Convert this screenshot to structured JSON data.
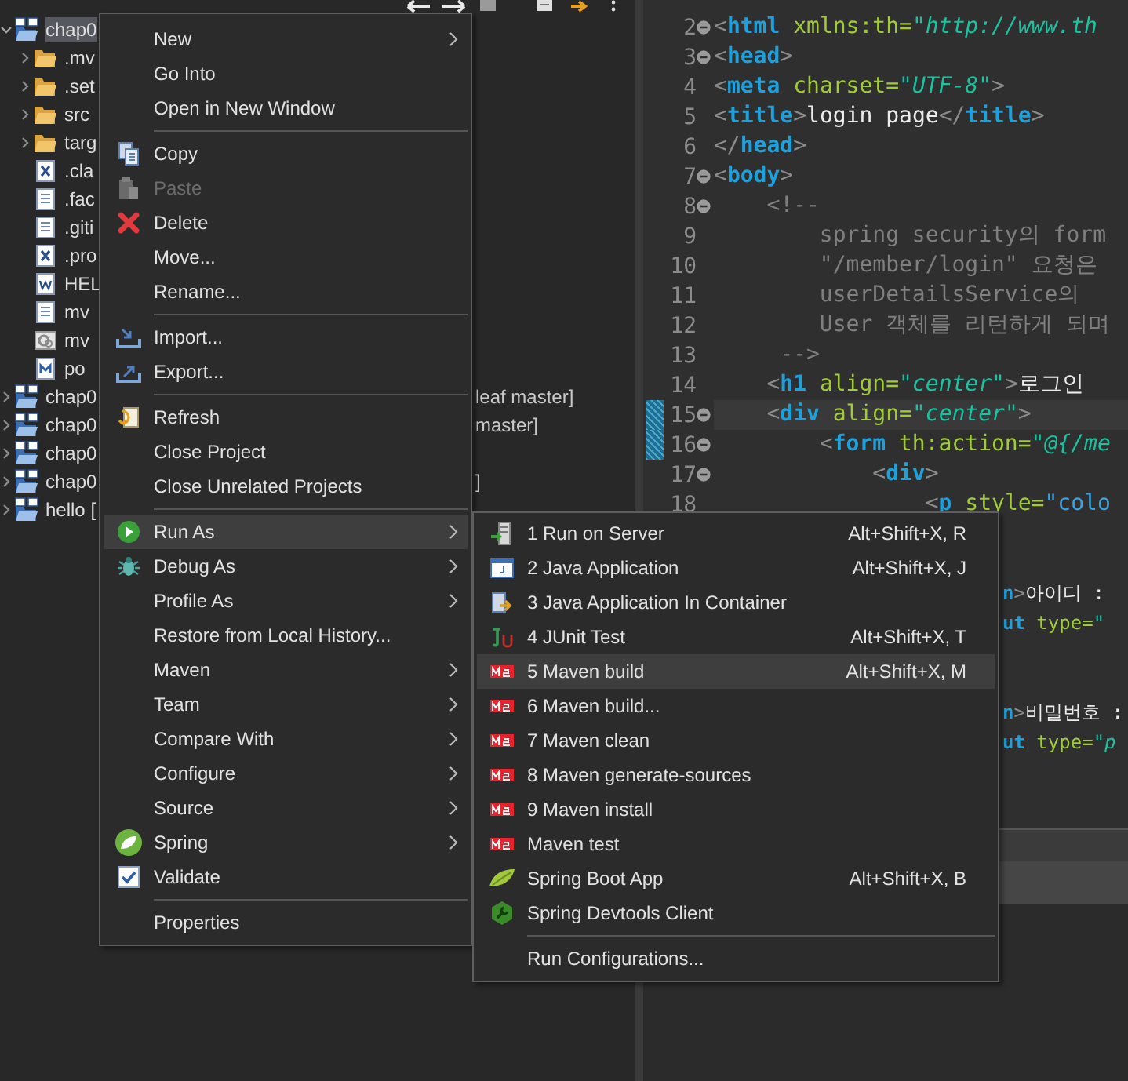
{
  "project_tree": [
    {
      "kind": "project",
      "label": "chap0",
      "selected": true,
      "expanded": true,
      "children": [
        {
          "kind": "folder",
          "label": ".mv",
          "selected": false,
          "expanded": false
        },
        {
          "kind": "folder",
          "label": ".set",
          "selected": false,
          "expanded": false
        },
        {
          "kind": "folder",
          "label": "src",
          "selected": false,
          "expanded": false
        },
        {
          "kind": "folder",
          "label": "targ",
          "selected": false,
          "expanded": false
        },
        {
          "kind": "file",
          "label": ".cla",
          "selected": false
        },
        {
          "kind": "file",
          "label": ".fac",
          "selected": false
        },
        {
          "kind": "file",
          "label": ".giti",
          "selected": false
        },
        {
          "kind": "file",
          "label": ".pro",
          "selected": false
        },
        {
          "kind": "file",
          "label": "HEL",
          "selected": false
        },
        {
          "kind": "file",
          "label": "mv",
          "selected": false
        },
        {
          "kind": "file",
          "label": "mv",
          "selected": false
        },
        {
          "kind": "file",
          "label": "po",
          "selected": false
        }
      ]
    },
    {
      "kind": "project",
      "label": "chap0",
      "selected": false,
      "expanded": false,
      "tail": "leaf master]"
    },
    {
      "kind": "project",
      "label": "chap0",
      "selected": false,
      "expanded": false,
      "tail": "master]"
    },
    {
      "kind": "project",
      "label": "chap0",
      "selected": false,
      "expanded": false
    },
    {
      "kind": "project",
      "label": "chap0",
      "selected": false,
      "expanded": false,
      "tail": "]"
    },
    {
      "kind": "project",
      "label": "hello [",
      "selected": false,
      "expanded": false
    }
  ],
  "editor": {
    "lines": [
      {
        "number": "2",
        "fold": true,
        "current": false,
        "marker": false,
        "tokens": [
          {
            "kind": "punct",
            "text": "<"
          },
          {
            "kind": "tag",
            "text": "html"
          },
          {
            "kind": "attr",
            "text": " xmlns:th="
          },
          {
            "kind": "value",
            "text": "\"http://www.th"
          }
        ]
      },
      {
        "number": "3",
        "fold": true,
        "current": false,
        "marker": false,
        "tokens": [
          {
            "kind": "punct",
            "text": "<"
          },
          {
            "kind": "tag",
            "text": "head"
          },
          {
            "kind": "punct",
            "text": ">"
          }
        ]
      },
      {
        "number": "4",
        "fold": false,
        "current": false,
        "marker": false,
        "tokens": [
          {
            "kind": "punct",
            "text": "<"
          },
          {
            "kind": "tag",
            "text": "meta"
          },
          {
            "kind": "attr",
            "text": " charset="
          },
          {
            "kind": "value",
            "text": "\"UTF-8\""
          },
          {
            "kind": "punct",
            "text": ">"
          }
        ]
      },
      {
        "number": "5",
        "fold": false,
        "current": false,
        "marker": false,
        "tokens": [
          {
            "kind": "punct",
            "text": "<"
          },
          {
            "kind": "tag",
            "text": "title"
          },
          {
            "kind": "punct",
            "text": ">"
          },
          {
            "kind": "text",
            "text": "login page"
          },
          {
            "kind": "punct",
            "text": "</"
          },
          {
            "kind": "tag",
            "text": "title"
          },
          {
            "kind": "punct",
            "text": ">"
          }
        ]
      },
      {
        "number": "6",
        "fold": false,
        "current": false,
        "marker": false,
        "tokens": [
          {
            "kind": "punct",
            "text": "</"
          },
          {
            "kind": "tag",
            "text": "head"
          },
          {
            "kind": "punct",
            "text": ">"
          }
        ]
      },
      {
        "number": "7",
        "fold": true,
        "current": false,
        "marker": false,
        "tokens": [
          {
            "kind": "punct",
            "text": "<"
          },
          {
            "kind": "tag",
            "text": "body"
          },
          {
            "kind": "punct",
            "text": ">"
          }
        ]
      },
      {
        "number": "8",
        "fold": true,
        "current": false,
        "marker": false,
        "tokens": [
          {
            "kind": "comment",
            "text": "    <!--"
          }
        ]
      },
      {
        "number": "9",
        "fold": false,
        "current": false,
        "marker": false,
        "tokens": [
          {
            "kind": "comment",
            "text": "        spring security의 form"
          }
        ]
      },
      {
        "number": "10",
        "fold": false,
        "current": false,
        "marker": false,
        "tokens": [
          {
            "kind": "comment",
            "text": "        \"/member/login\" 요청은"
          }
        ]
      },
      {
        "number": "11",
        "fold": false,
        "current": false,
        "marker": false,
        "tokens": [
          {
            "kind": "comment",
            "text": "        userDetailsService의"
          }
        ]
      },
      {
        "number": "12",
        "fold": false,
        "current": false,
        "marker": false,
        "tokens": [
          {
            "kind": "comment",
            "text": "        User 객체를 리턴하게 되며"
          }
        ]
      },
      {
        "number": "13",
        "fold": false,
        "current": false,
        "marker": false,
        "tokens": [
          {
            "kind": "comment",
            "text": "     -->"
          }
        ]
      },
      {
        "number": "14",
        "fold": false,
        "current": false,
        "marker": false,
        "tokens": [
          {
            "kind": "punct",
            "text": "    <"
          },
          {
            "kind": "tag",
            "text": "h1"
          },
          {
            "kind": "attr",
            "text": " align="
          },
          {
            "kind": "value",
            "text": "\"center\""
          },
          {
            "kind": "punct",
            "text": ">"
          },
          {
            "kind": "text",
            "text": "로그인"
          }
        ]
      },
      {
        "number": "15",
        "fold": true,
        "current": true,
        "marker": true,
        "tokens": [
          {
            "kind": "punct",
            "text": "    <"
          },
          {
            "kind": "tag",
            "text": "div"
          },
          {
            "kind": "attr",
            "text": " align="
          },
          {
            "kind": "value",
            "text": "\"center\""
          },
          {
            "kind": "punct",
            "text": ">"
          }
        ]
      },
      {
        "number": "16",
        "fold": true,
        "current": false,
        "marker": true,
        "tokens": [
          {
            "kind": "punct",
            "text": "        <"
          },
          {
            "kind": "tag",
            "text": "form"
          },
          {
            "kind": "attr",
            "text": " th:action="
          },
          {
            "kind": "value",
            "text": "\"@{/me"
          }
        ]
      },
      {
        "number": "17",
        "fold": true,
        "current": false,
        "marker": false,
        "tokens": [
          {
            "kind": "punct",
            "text": "            <"
          },
          {
            "kind": "tag",
            "text": "div"
          },
          {
            "kind": "punct",
            "text": ">"
          }
        ]
      },
      {
        "number": "18",
        "fold": false,
        "current": false,
        "marker": false,
        "tokens": [
          {
            "kind": "punct",
            "text": "                <"
          },
          {
            "kind": "tag",
            "text": "p"
          },
          {
            "kind": "attr",
            "text": " style="
          },
          {
            "kind": "css",
            "text": "\"colo"
          }
        ]
      }
    ],
    "covered_blocks": [
      {
        "lines": [
          {
            "tokens": [
              {
                "kind": "tag",
                "text": "n"
              },
              {
                "kind": "punct",
                "text": ">"
              },
              {
                "kind": "text",
                "text": "아이디 :"
              }
            ]
          },
          {
            "tokens": [
              {
                "kind": "tag",
                "text": "ut"
              },
              {
                "kind": "attr",
                "text": " type="
              },
              {
                "kind": "value",
                "text": "\""
              }
            ]
          }
        ]
      },
      {
        "lines": [
          {
            "tokens": [
              {
                "kind": "tag",
                "text": "n"
              },
              {
                "kind": "punct",
                "text": ">"
              },
              {
                "kind": "text",
                "text": "비밀번호 :"
              }
            ]
          },
          {
            "tokens": [
              {
                "kind": "tag",
                "text": "ut"
              },
              {
                "kind": "attr",
                "text": " type="
              },
              {
                "kind": "value",
                "text": "\"p"
              }
            ]
          }
        ]
      }
    ]
  },
  "context_menu": [
    {
      "kind": "item",
      "label": "New",
      "submenu": true,
      "disabled": false,
      "selected": false
    },
    {
      "kind": "item",
      "label": "Go Into",
      "submenu": false,
      "disabled": false,
      "selected": false
    },
    {
      "kind": "item",
      "label": "Open in New Window",
      "submenu": false,
      "disabled": false,
      "selected": false
    },
    {
      "kind": "separator"
    },
    {
      "kind": "item",
      "label": "Copy",
      "submenu": false,
      "disabled": false,
      "selected": false
    },
    {
      "kind": "item",
      "label": "Paste",
      "submenu": false,
      "disabled": true,
      "selected": false
    },
    {
      "kind": "item",
      "label": "Delete",
      "submenu": false,
      "disabled": false,
      "selected": false
    },
    {
      "kind": "item",
      "label": "Move...",
      "submenu": false,
      "disabled": false,
      "selected": false
    },
    {
      "kind": "item",
      "label": "Rename...",
      "submenu": false,
      "disabled": false,
      "selected": false
    },
    {
      "kind": "separator"
    },
    {
      "kind": "item",
      "label": "Import...",
      "submenu": false,
      "disabled": false,
      "selected": false
    },
    {
      "kind": "item",
      "label": "Export...",
      "submenu": false,
      "disabled": false,
      "selected": false
    },
    {
      "kind": "separator"
    },
    {
      "kind": "item",
      "label": "Refresh",
      "submenu": false,
      "disabled": false,
      "selected": false
    },
    {
      "kind": "item",
      "label": "Close Project",
      "submenu": false,
      "disabled": false,
      "selected": false
    },
    {
      "kind": "item",
      "label": "Close Unrelated Projects",
      "submenu": false,
      "disabled": false,
      "selected": false
    },
    {
      "kind": "separator"
    },
    {
      "kind": "item",
      "label": "Run As",
      "submenu": true,
      "disabled": false,
      "selected": true
    },
    {
      "kind": "item",
      "label": "Debug As",
      "submenu": true,
      "disabled": false,
      "selected": false
    },
    {
      "kind": "item",
      "label": "Profile As",
      "submenu": true,
      "disabled": false,
      "selected": false
    },
    {
      "kind": "item",
      "label": "Restore from Local History...",
      "submenu": false,
      "disabled": false,
      "selected": false
    },
    {
      "kind": "item",
      "label": "Maven",
      "submenu": true,
      "disabled": false,
      "selected": false
    },
    {
      "kind": "item",
      "label": "Team",
      "submenu": true,
      "disabled": false,
      "selected": false
    },
    {
      "kind": "item",
      "label": "Compare With",
      "submenu": true,
      "disabled": false,
      "selected": false
    },
    {
      "kind": "item",
      "label": "Configure",
      "submenu": true,
      "disabled": false,
      "selected": false
    },
    {
      "kind": "item",
      "label": "Source",
      "submenu": true,
      "disabled": false,
      "selected": false
    },
    {
      "kind": "item",
      "label": "Spring",
      "submenu": true,
      "disabled": false,
      "selected": false
    },
    {
      "kind": "item",
      "label": "Validate",
      "submenu": false,
      "disabled": false,
      "selected": false
    },
    {
      "kind": "separator"
    },
    {
      "kind": "item",
      "label": "Properties",
      "submenu": false,
      "disabled": false,
      "selected": false
    }
  ],
  "run_as_submenu": [
    {
      "kind": "item",
      "label": "1 Run on Server",
      "shortcut": "Alt+Shift+X, R",
      "selected": false
    },
    {
      "kind": "item",
      "label": "2 Java Application",
      "shortcut": "Alt+Shift+X, J",
      "selected": false
    },
    {
      "kind": "item",
      "label": "3 Java Application In Container",
      "selected": false
    },
    {
      "kind": "item",
      "label": "4 JUnit Test",
      "shortcut": "Alt+Shift+X, T",
      "selected": false
    },
    {
      "kind": "item",
      "label": "5 Maven build",
      "shortcut": "Alt+Shift+X, M",
      "selected": true
    },
    {
      "kind": "item",
      "label": "6 Maven build...",
      "selected": false
    },
    {
      "kind": "item",
      "label": "7 Maven clean",
      "selected": false
    },
    {
      "kind": "item",
      "label": "8 Maven generate-sources",
      "selected": false
    },
    {
      "kind": "item",
      "label": "9 Maven install",
      "selected": false
    },
    {
      "kind": "item",
      "label": "Maven test",
      "selected": false
    },
    {
      "kind": "item",
      "label": "Spring Boot App",
      "shortcut": "Alt+Shift+X, B",
      "selected": false
    },
    {
      "kind": "item",
      "label": "Spring Devtools Client",
      "selected": false
    },
    {
      "kind": "separator"
    },
    {
      "kind": "item",
      "label": "Run Configurations...",
      "selected": false
    }
  ]
}
